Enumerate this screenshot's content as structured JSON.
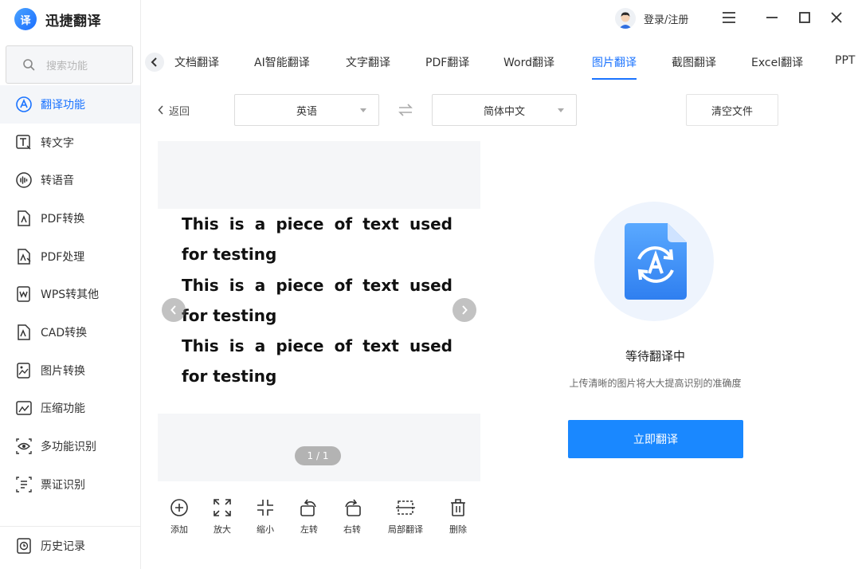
{
  "app": {
    "logo_char": "译",
    "title": "迅捷翻译"
  },
  "search": {
    "placeholder": "搜索功能"
  },
  "sidebar": {
    "items": [
      {
        "label": "翻译功能",
        "icon": "translate-icon",
        "active": true
      },
      {
        "label": "转文字",
        "icon": "text-convert-icon"
      },
      {
        "label": "转语音",
        "icon": "voice-icon"
      },
      {
        "label": "PDF转换",
        "icon": "pdf-convert-icon"
      },
      {
        "label": "PDF处理",
        "icon": "pdf-process-icon"
      },
      {
        "label": "WPS转其他",
        "icon": "wps-icon"
      },
      {
        "label": "CAD转换",
        "icon": "cad-icon"
      },
      {
        "label": "图片转换",
        "icon": "image-convert-icon"
      },
      {
        "label": "压缩功能",
        "icon": "compress-icon"
      },
      {
        "label": "多功能识别",
        "icon": "eye-icon"
      },
      {
        "label": "票证识别",
        "icon": "ticket-icon"
      }
    ],
    "bottom": {
      "label": "历史记录",
      "icon": "history-icon"
    }
  },
  "header": {
    "login_label": "登录/注册"
  },
  "tabs": [
    {
      "label": "文档翻译"
    },
    {
      "label": "AI智能翻译"
    },
    {
      "label": "文字翻译"
    },
    {
      "label": "PDF翻译"
    },
    {
      "label": "Word翻译"
    },
    {
      "label": "图片翻译",
      "active": true
    },
    {
      "label": "截图翻译"
    },
    {
      "label": "Excel翻译"
    },
    {
      "label": "PPT"
    }
  ],
  "controls": {
    "back_label": "返回",
    "source_lang": "英语",
    "target_lang": "简体中文",
    "clear_label": "清空文件"
  },
  "preview": {
    "lines": [
      "This is a piece of text used for testing",
      "This is a piece of text used for testing",
      "This is a piece of text used for testing"
    ],
    "pager": "1 / 1"
  },
  "tools": [
    {
      "label": "添加",
      "icon": "add-icon"
    },
    {
      "label": "放大",
      "icon": "zoom-in-icon"
    },
    {
      "label": "缩小",
      "icon": "zoom-out-icon"
    },
    {
      "label": "左转",
      "icon": "rotate-left-icon"
    },
    {
      "label": "右转",
      "icon": "rotate-right-icon"
    },
    {
      "label": "局部翻译",
      "icon": "partial-translate-icon"
    },
    {
      "label": "删除",
      "icon": "delete-icon"
    }
  ],
  "result": {
    "status": "等待翻译中",
    "hint": "上传清晰的图片将大大提高识别的准确度",
    "button_label": "立即翻译"
  },
  "colors": {
    "accent": "#1a73ff",
    "button": "#1a88ff"
  }
}
